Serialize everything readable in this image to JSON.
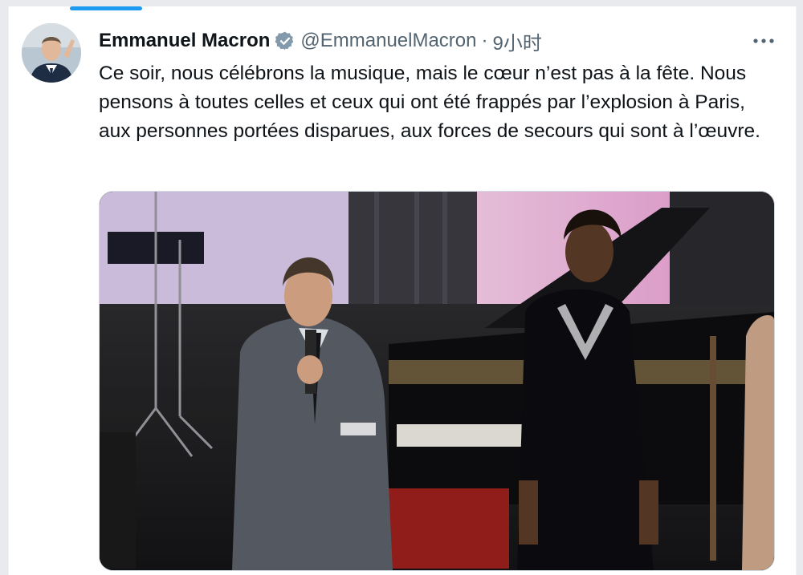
{
  "tweet": {
    "author_name": "Emmanuel Macron",
    "handle": "@EmmanuelMacron",
    "separator": "·",
    "time": "9小时",
    "text": "Ce soir, nous célébrons la musique, mais le cœur n’est pas à la fête. Nous pensons à toutes celles et ceux qui ont été frappés par l’explosion à Paris, aux personnes portées disparues, aux forces de secours qui sont à l’œuvre.",
    "verified": true
  },
  "icons": {
    "verified": "verified-badge-icon",
    "more": "more-options-icon"
  },
  "colors": {
    "accent": "#1d9bf0",
    "text": "#0f1419",
    "secondary": "#536471"
  }
}
